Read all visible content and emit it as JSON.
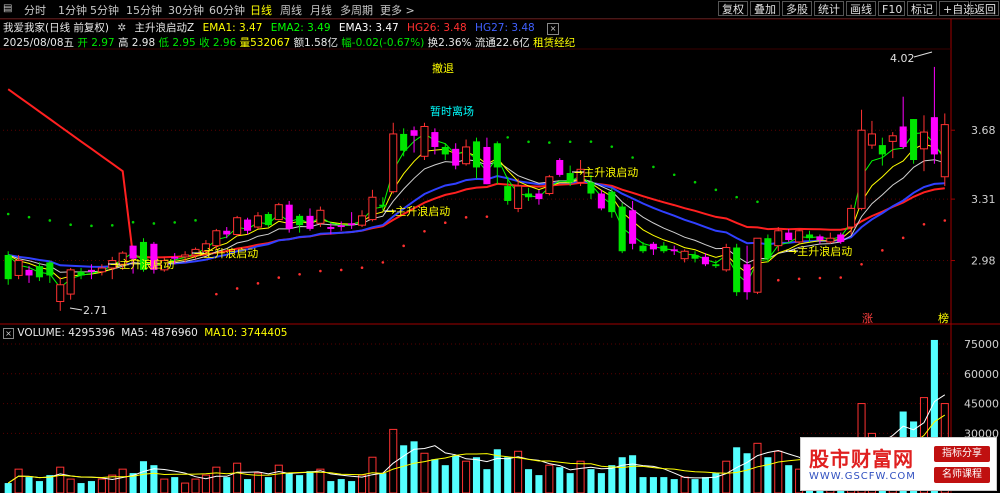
{
  "toolbar": {
    "tabs": [
      "分时",
      "1分钟",
      "5分钟",
      "15分钟",
      "30分钟",
      "60分钟",
      "日线",
      "周线",
      "月线",
      "多周期",
      "更多 >"
    ],
    "active_tab": "日线",
    "right_buttons": [
      "复权",
      "叠加",
      "多股",
      "统计",
      "画线",
      "F10",
      "标记",
      "+自选",
      "返回"
    ]
  },
  "indicator_line": {
    "stock_name": "我爱我家(日线 前复权)",
    "formula_name": "主升浪启动Z",
    "ema1_label": "EMA1: 3.47",
    "ema2_label": "EMA2: 3.49",
    "ema3_label": "EMA3: 3.47",
    "hg26_label": "HG26: 3.48",
    "hg27_label": "HG27: 3.48",
    "close_box": "×"
  },
  "quote_line": {
    "date": "2025/08/08五",
    "open": "开 2.97",
    "high": "高 2.98",
    "low": "低 2.95",
    "close": "收 2.96",
    "volume": "量532067",
    "amount": "额1.58亿",
    "change": "幅-0.02(-0.67%)",
    "turnover": "换2.36%",
    "float": "流通22.6亿",
    "sector": "租赁经纪"
  },
  "annotations": {
    "retreat": "撤退",
    "temp_exit": "暂时离场",
    "high_mark": "4.02",
    "low_mark": "2.71",
    "start_label": "主升浪启动",
    "zhang": "涨",
    "bang": "榜"
  },
  "volume_info": {
    "volume": "VOLUME: 4295396",
    "ma5": "MA5: 4876960",
    "ma10": "MA10: 3744405",
    "close_box": "×"
  },
  "watermark": {
    "title": "股市财富网",
    "url": "WWW.GSCFW.COM",
    "tag1": "指标分享",
    "tag2": "名师课程"
  },
  "colors": {
    "up": "#ff3232",
    "down": "#00e600",
    "magenta": "#ff00ff",
    "ema_white": "#ffffff",
    "ema_yellow": "#ffff00",
    "ema_green": "#00ff00",
    "hg26_red": "#ff2020",
    "hg27_blue": "#3040ff",
    "volume_cyan": "#54ffff"
  },
  "chart_data": {
    "type": "candlestick",
    "price_axis_ticks": [
      3.68,
      3.31,
      2.98
    ],
    "volume_axis_ticks": [
      75000,
      60000,
      45000,
      30000
    ],
    "price_range": [
      2.65,
      4.1
    ],
    "volume_range": [
      0,
      80000
    ],
    "candles": [
      {
        "o": 2.88,
        "h": 3.03,
        "l": 2.85,
        "c": 3.01
      },
      {
        "o": 2.98,
        "h": 3.01,
        "l": 2.88,
        "c": 2.9
      },
      {
        "o": 2.9,
        "h": 2.95,
        "l": 2.86,
        "c": 2.93
      },
      {
        "o": 2.95,
        "h": 2.97,
        "l": 2.87,
        "c": 2.89
      },
      {
        "o": 2.97,
        "h": 2.98,
        "l": 2.86,
        "c": 2.9
      },
      {
        "o": 2.85,
        "h": 2.89,
        "l": 2.71,
        "c": 2.76
      },
      {
        "o": 2.8,
        "h": 2.94,
        "l": 2.77,
        "c": 2.93
      },
      {
        "o": 2.9,
        "h": 2.94,
        "l": 2.88,
        "c": 2.92
      },
      {
        "o": 2.93,
        "h": 2.96,
        "l": 2.88,
        "c": 2.92
      },
      {
        "o": 2.92,
        "h": 2.96,
        "l": 2.9,
        "c": 2.94
      },
      {
        "o": 2.94,
        "h": 3.0,
        "l": 2.88,
        "c": 2.98
      },
      {
        "o": 2.96,
        "h": 3.03,
        "l": 2.93,
        "c": 3.02
      },
      {
        "o": 2.99,
        "h": 3.06,
        "l": 2.91,
        "c": 3.06
      },
      {
        "o": 3.08,
        "h": 3.1,
        "l": 2.92,
        "c": 2.93
      },
      {
        "o": 3.07,
        "h": 3.08,
        "l": 2.91,
        "c": 2.93
      },
      {
        "o": 2.93,
        "h": 3.0,
        "l": 2.92,
        "c": 2.98
      },
      {
        "o": 2.99,
        "h": 3.02,
        "l": 2.96,
        "c": 3.0
      },
      {
        "o": 3.0,
        "h": 3.03,
        "l": 2.97,
        "c": 3.01
      },
      {
        "o": 3.01,
        "h": 3.05,
        "l": 2.99,
        "c": 3.04
      },
      {
        "o": 3.03,
        "h": 3.09,
        "l": 3.01,
        "c": 3.07
      },
      {
        "o": 3.06,
        "h": 3.15,
        "l": 3.04,
        "c": 3.14
      },
      {
        "o": 3.14,
        "h": 3.16,
        "l": 3.1,
        "c": 3.12
      },
      {
        "o": 3.12,
        "h": 3.22,
        "l": 3.11,
        "c": 3.21
      },
      {
        "o": 3.2,
        "h": 3.21,
        "l": 3.12,
        "c": 3.14
      },
      {
        "o": 3.16,
        "h": 3.24,
        "l": 3.15,
        "c": 3.22
      },
      {
        "o": 3.23,
        "h": 3.24,
        "l": 3.16,
        "c": 3.17
      },
      {
        "o": 3.2,
        "h": 3.29,
        "l": 3.2,
        "c": 3.28
      },
      {
        "o": 3.28,
        "h": 3.3,
        "l": 3.13,
        "c": 3.15
      },
      {
        "o": 3.17,
        "h": 3.23,
        "l": 3.13,
        "c": 3.22
      },
      {
        "o": 3.22,
        "h": 3.26,
        "l": 3.14,
        "c": 3.15
      },
      {
        "o": 3.18,
        "h": 3.27,
        "l": 3.16,
        "c": 3.25
      },
      {
        "o": 3.16,
        "h": 3.18,
        "l": 3.12,
        "c": 3.15
      },
      {
        "o": 3.17,
        "h": 3.19,
        "l": 3.14,
        "c": 3.16
      },
      {
        "o": 3.18,
        "h": 3.24,
        "l": 3.15,
        "c": 3.17
      },
      {
        "o": 3.17,
        "h": 3.25,
        "l": 3.16,
        "c": 3.22
      },
      {
        "o": 3.2,
        "h": 3.36,
        "l": 3.19,
        "c": 3.32
      },
      {
        "o": 3.27,
        "h": 3.32,
        "l": 3.25,
        "c": 3.28
      },
      {
        "o": 3.35,
        "h": 3.72,
        "l": 3.34,
        "c": 3.66
      },
      {
        "o": 3.57,
        "h": 3.69,
        "l": 3.54,
        "c": 3.66
      },
      {
        "o": 3.65,
        "h": 3.7,
        "l": 3.56,
        "c": 3.68
      },
      {
        "o": 3.54,
        "h": 3.72,
        "l": 3.52,
        "c": 3.7
      },
      {
        "o": 3.67,
        "h": 3.69,
        "l": 3.55,
        "c": 3.59
      },
      {
        "o": 3.55,
        "h": 3.61,
        "l": 3.52,
        "c": 3.59
      },
      {
        "o": 3.58,
        "h": 3.61,
        "l": 3.47,
        "c": 3.49
      },
      {
        "o": 3.5,
        "h": 3.63,
        "l": 3.49,
        "c": 3.59
      },
      {
        "o": 3.62,
        "h": 3.64,
        "l": 3.42,
        "c": 3.48
      },
      {
        "o": 3.59,
        "h": 3.64,
        "l": 3.39,
        "c": 3.39
      },
      {
        "o": 3.48,
        "h": 3.62,
        "l": 3.39,
        "c": 3.61
      },
      {
        "o": 3.38,
        "h": 3.43,
        "l": 3.28,
        "c": 3.3
      },
      {
        "o": 3.38,
        "h": 3.42,
        "l": 3.24,
        "c": 3.26
      },
      {
        "o": 3.34,
        "h": 3.37,
        "l": 3.3,
        "c": 3.32
      },
      {
        "o": 3.34,
        "h": 3.36,
        "l": 3.28,
        "c": 3.31
      },
      {
        "o": 3.34,
        "h": 3.44,
        "l": 3.33,
        "c": 3.43
      },
      {
        "o": 3.52,
        "h": 3.53,
        "l": 3.43,
        "c": 3.44
      },
      {
        "o": 3.45,
        "h": 3.49,
        "l": 3.38,
        "c": 3.4
      },
      {
        "o": 3.4,
        "h": 3.52,
        "l": 3.38,
        "c": 3.47
      },
      {
        "o": 3.4,
        "h": 3.44,
        "l": 3.31,
        "c": 3.34
      },
      {
        "o": 3.34,
        "h": 3.36,
        "l": 3.25,
        "c": 3.26
      },
      {
        "o": 3.35,
        "h": 3.37,
        "l": 3.21,
        "c": 3.24
      },
      {
        "o": 3.27,
        "h": 3.29,
        "l": 3.02,
        "c": 3.03
      },
      {
        "o": 3.25,
        "h": 3.3,
        "l": 3.04,
        "c": 3.07
      },
      {
        "o": 3.06,
        "h": 3.08,
        "l": 3.02,
        "c": 3.03
      },
      {
        "o": 3.07,
        "h": 3.08,
        "l": 3.01,
        "c": 3.04
      },
      {
        "o": 3.06,
        "h": 3.08,
        "l": 3.02,
        "c": 3.03
      },
      {
        "o": 3.04,
        "h": 3.06,
        "l": 3.01,
        "c": 3.03
      },
      {
        "o": 3.03,
        "h": 3.04,
        "l": 2.97,
        "c": 2.99
      },
      {
        "o": 2.99,
        "h": 3.03,
        "l": 2.97,
        "c": 3.01
      },
      {
        "o": 3.0,
        "h": 3.02,
        "l": 2.95,
        "c": 2.96
      },
      {
        "o": 2.96,
        "h": 2.98,
        "l": 2.94,
        "c": 2.95
      },
      {
        "o": 2.93,
        "h": 3.07,
        "l": 2.92,
        "c": 3.05
      },
      {
        "o": 3.05,
        "h": 3.07,
        "l": 2.79,
        "c": 2.81
      },
      {
        "o": 2.96,
        "h": 3.06,
        "l": 2.77,
        "c": 2.81
      },
      {
        "o": 2.81,
        "h": 3.1,
        "l": 2.8,
        "c": 3.1
      },
      {
        "o": 3.1,
        "h": 3.12,
        "l": 2.97,
        "c": 2.99
      },
      {
        "o": 3.06,
        "h": 3.16,
        "l": 3.03,
        "c": 3.14
      },
      {
        "o": 3.13,
        "h": 3.15,
        "l": 3.08,
        "c": 3.09
      },
      {
        "o": 3.08,
        "h": 3.15,
        "l": 3.07,
        "c": 3.14
      },
      {
        "o": 3.12,
        "h": 3.14,
        "l": 3.08,
        "c": 3.1
      },
      {
        "o": 3.09,
        "h": 3.12,
        "l": 3.07,
        "c": 3.11
      },
      {
        "o": 3.1,
        "h": 3.13,
        "l": 3.07,
        "c": 3.08
      },
      {
        "o": 3.08,
        "h": 3.13,
        "l": 3.07,
        "c": 3.12
      },
      {
        "o": 3.16,
        "h": 3.28,
        "l": 3.12,
        "c": 3.26
      },
      {
        "o": 3.26,
        "h": 3.79,
        "l": 3.25,
        "c": 3.68
      },
      {
        "o": 3.66,
        "h": 3.73,
        "l": 3.58,
        "c": 3.6
      },
      {
        "o": 3.6,
        "h": 3.64,
        "l": 3.49,
        "c": 3.55
      },
      {
        "o": 3.65,
        "h": 3.67,
        "l": 3.53,
        "c": 3.62
      },
      {
        "o": 3.7,
        "h": 3.86,
        "l": 3.58,
        "c": 3.59
      },
      {
        "o": 3.52,
        "h": 3.74,
        "l": 3.5,
        "c": 3.74
      },
      {
        "o": 3.58,
        "h": 3.76,
        "l": 3.46,
        "c": 3.67
      },
      {
        "o": 3.75,
        "h": 4.02,
        "l": 3.5,
        "c": 3.55
      },
      {
        "o": 3.71,
        "h": 3.77,
        "l": 3.38,
        "c": 3.43
      }
    ],
    "candle_colors": [
      "d",
      "u",
      "m",
      "d",
      "d",
      "u",
      "u",
      "d",
      "m",
      "u",
      "u",
      "u",
      "m",
      "d",
      "m",
      "u",
      "m",
      "u",
      "u",
      "u",
      "u",
      "m",
      "u",
      "m",
      "u",
      "d",
      "u",
      "m",
      "d",
      "m",
      "u",
      "m",
      "m",
      "m",
      "u",
      "u",
      "d",
      "u",
      "d",
      "m",
      "u",
      "m",
      "d",
      "m",
      "u",
      "d",
      "m",
      "d",
      "d",
      "u",
      "d",
      "m",
      "u",
      "m",
      "d",
      "u",
      "d",
      "m",
      "d",
      "d",
      "m",
      "d",
      "m",
      "d",
      "m",
      "u",
      "d",
      "m",
      "d",
      "u",
      "d",
      "m",
      "u",
      "d",
      "u",
      "m",
      "u",
      "d",
      "m",
      "u",
      "m",
      "u",
      "u",
      "u",
      "d",
      "u",
      "m",
      "d",
      "u",
      "m",
      "u",
      "d"
    ],
    "volume": [
      5000,
      12000,
      8000,
      6000,
      9000,
      13000,
      7000,
      5000,
      6000,
      7000,
      9000,
      12000,
      10000,
      16000,
      14000,
      7000,
      8000,
      5000,
      7000,
      9000,
      13000,
      8000,
      15000,
      7000,
      10000,
      8000,
      14000,
      10000,
      9000,
      11000,
      12000,
      6000,
      7000,
      6000,
      9000,
      18000,
      10000,
      32000,
      24000,
      26000,
      20000,
      17000,
      14000,
      19000,
      16000,
      18000,
      12000,
      22000,
      18000,
      21000,
      12000,
      9000,
      14000,
      13000,
      10000,
      16000,
      12000,
      10000,
      14000,
      18000,
      19000,
      8000,
      8000,
      8000,
      7000,
      8000,
      7000,
      8000,
      10000,
      16000,
      23000,
      20000,
      25000,
      18000,
      21000,
      14000,
      12000,
      10000,
      10000,
      9000,
      11000,
      18000,
      45000,
      30000,
      24000,
      28000,
      41000,
      36000,
      48000,
      77000,
      45000
    ]
  }
}
